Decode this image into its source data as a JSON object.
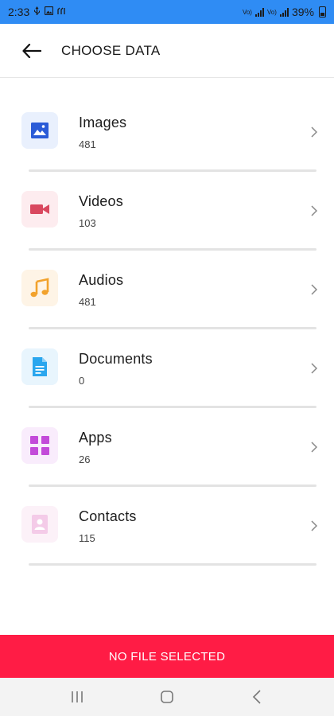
{
  "status_bar": {
    "time": "2:33",
    "network_label": "Vo)",
    "network_sub": "LTE1",
    "network2_label": "Vo)",
    "network2_sub": "LTE2",
    "battery": "39%"
  },
  "app_bar": {
    "title": "CHOOSE DATA"
  },
  "categories": [
    {
      "title": "Images",
      "count": "481",
      "icon": "image-icon",
      "color": "#2a5bd7",
      "bg": "#e9f0fd"
    },
    {
      "title": "Videos",
      "count": "103",
      "icon": "video-icon",
      "color": "#d9485f",
      "bg": "#fdecef"
    },
    {
      "title": "Audios",
      "count": "481",
      "icon": "music-note-icon",
      "color": "#f2a22c",
      "bg": "#fef4e6"
    },
    {
      "title": "Documents",
      "count": "0",
      "icon": "document-icon",
      "color": "#2aa6ee",
      "bg": "#e8f5fd"
    },
    {
      "title": "Apps",
      "count": "26",
      "icon": "apps-grid-icon",
      "color": "#c34bd9",
      "bg": "#f9ecfc"
    },
    {
      "title": "Contacts",
      "count": "115",
      "icon": "contact-card-icon",
      "color": "#f1b9e0",
      "bg": "#fcf1f8"
    }
  ],
  "action_bar": {
    "label": "NO FILE SELECTED",
    "color": "#ff1c45"
  }
}
